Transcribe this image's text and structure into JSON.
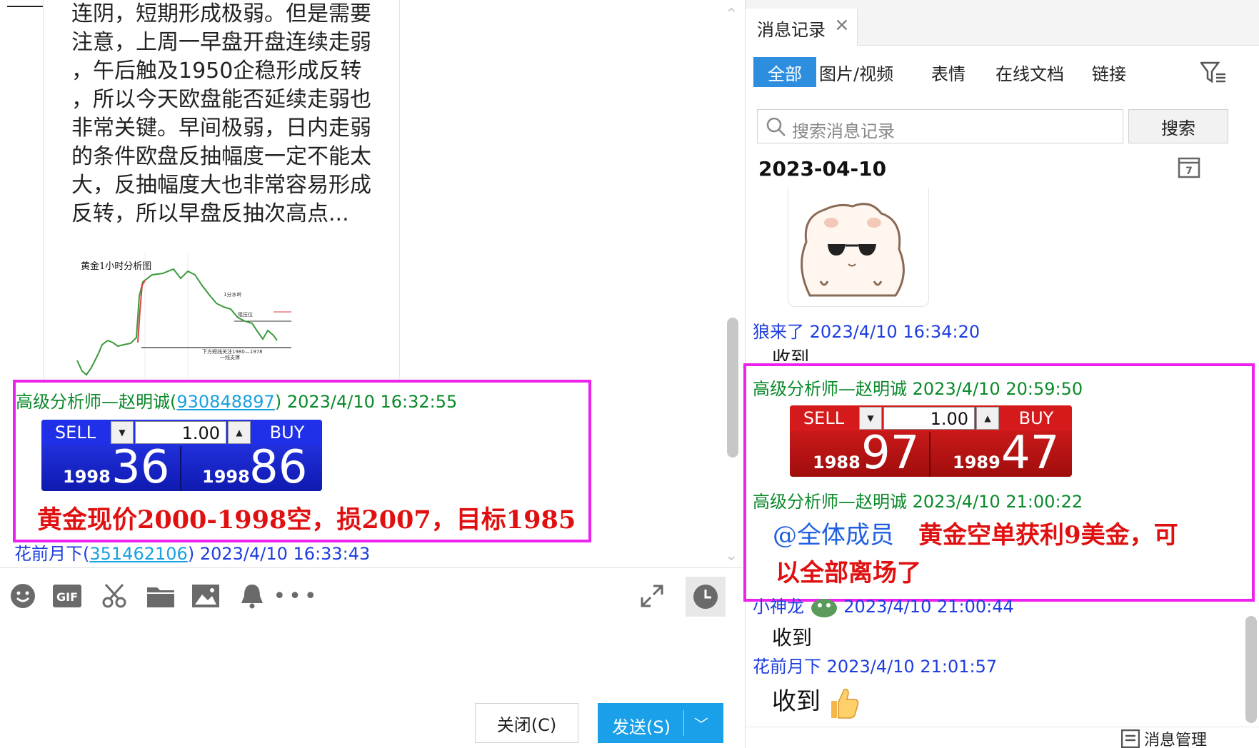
{
  "post": {
    "text": "连阴，短期形成极弱。但是需要\n注意，上周一早盘开盘连续走弱\n，午后触及1950企稳形成反转\n，所以今天欧盘能否延续走弱也\n非常关键。早间极弱，日内走弱\n的条件欧盘反抽幅度一定不能太\n大，反抽幅度大也非常容易形成\n反转，所以早盘反抽次高点...",
    "chart_title": "黄金1小时分析图"
  },
  "chat": {
    "msg1": {
      "sender": "高级分析师—赵明诚(",
      "sender_id": "930848897",
      "sender_close": ")",
      "time": "2023/4/10 16:32:55",
      "widget": {
        "sell_label": "SELL",
        "buy_label": "BUY",
        "quantity": "1.00",
        "sell_small": "1998",
        "sell_big": "36",
        "buy_small": "1998",
        "buy_big": "86"
      },
      "text": "黄金现价2000-1998空，损2007，目标1985"
    },
    "msg2": {
      "sender": "花前月下(",
      "sender_id": "351462106",
      "sender_close": ")",
      "time": "2023/4/10 16:33:43"
    }
  },
  "composer": {
    "close_label": "关闭(C)",
    "send_label": "发送(S)"
  },
  "history": {
    "tab_title": "消息记录",
    "filters": [
      "全部",
      "图片/视频",
      "表情",
      "在线文档",
      "链接"
    ],
    "search_placeholder": "搜索消息记录",
    "search_button": "搜索",
    "date": "2023-04-10",
    "calendar_day": "7",
    "messages": [
      {
        "sender": "狼来了",
        "time": "2023/4/10 16:34:20",
        "text": "收到"
      },
      {
        "sender": "高级分析师—赵明诚",
        "time": "2023/4/10 20:59:50"
      },
      {
        "sender": "高级分析师—赵明诚",
        "time": "2023/4/10 21:00:22"
      },
      {
        "sender": "小神龙",
        "time": "2023/4/10 21:00:44",
        "text": "收到"
      },
      {
        "sender": "花前月下",
        "time": "2023/4/10 21:01:57",
        "text": "收到"
      }
    ],
    "widget": {
      "sell_label": "SELL",
      "buy_label": "BUY",
      "quantity": "1.00",
      "sell_small": "1988",
      "sell_big": "97",
      "buy_small": "1989",
      "buy_big": "47"
    },
    "mention": "@全体成员",
    "callout_line1": "黄金空单获利9美金，可",
    "callout_line2": "以全部离场了",
    "manage_label": "消息管理"
  },
  "colors": {
    "highlight": "#ee22ee",
    "callout_red": "#e01010",
    "analyst_green": "#0a8a2a",
    "user_blue": "#1e3ee0",
    "send_blue": "#1aa0e8"
  }
}
